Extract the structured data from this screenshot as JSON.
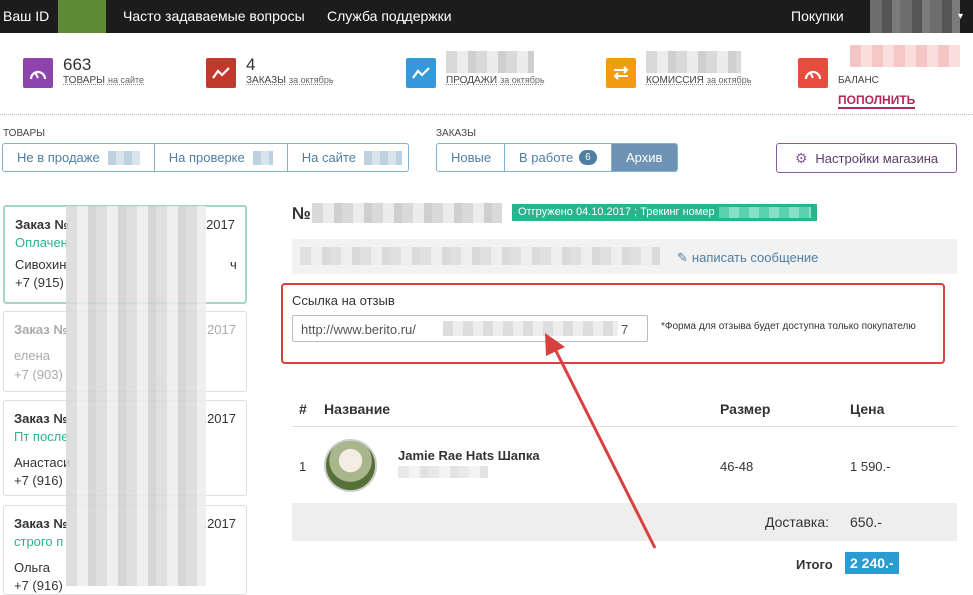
{
  "topbar": {
    "brand": "Ваш ID",
    "faq": "Часто задаваемые вопросы",
    "support": "Служба поддержки",
    "purchases": "Покупки",
    "dropdown": "▾"
  },
  "stats": {
    "products": {
      "value": "663",
      "label": "ТОВАРЫ",
      "sub": "на сайте",
      "color": "#8e44ad"
    },
    "orders": {
      "value": "4",
      "label": "ЗАКАЗЫ",
      "sub": "за октябрь",
      "color": "#c0392b"
    },
    "sales": {
      "label": "ПРОДАЖИ",
      "sub": "за октябрь",
      "color": "#3498db"
    },
    "commission": {
      "label": "КОМИССИЯ",
      "sub": "за октябрь",
      "color": "#f39c12"
    },
    "balance": {
      "label": "БАЛАНС",
      "topup": "ПОПОЛНИТЬ",
      "color": "#e74c3c"
    }
  },
  "goods_section": {
    "title": "ТОВАРЫ",
    "tabs": [
      "Не в продаже",
      "На проверке",
      "На сайте"
    ]
  },
  "orders_section": {
    "title": "ЗАКАЗЫ",
    "tabs": [
      "Новые",
      "В работе",
      "Архив"
    ],
    "in_work_count": "6"
  },
  "settings_label": "Настройки магазина",
  "order_cards": [
    {
      "title": "Заказ №",
      "date": ".2017",
      "status": "Оплачен",
      "name": "Сивохин",
      "name_end": "ч",
      "phone": "+7 (915)",
      "status_color": "#2bb38e"
    },
    {
      "title": "Заказ №",
      "date": ".2017",
      "status": "",
      "name": "елена",
      "name_end": "",
      "phone": "+7 (903)",
      "status_color": "#2bb38e"
    },
    {
      "title": "Заказ №",
      "date": ".2017",
      "status": "Пт после",
      "name": "Анастаси",
      "name_end": "",
      "phone": "+7 (916)",
      "status_color": "#2bb38e"
    },
    {
      "title": "Заказ №",
      "date": ".2017",
      "status": "строго п",
      "name": "Ольга",
      "name_end": "",
      "phone": "+7 (916)",
      "status_color": "#2bb38e"
    }
  ],
  "detail": {
    "order_prefix": "№",
    "shipped": "Отгружено 04.10.2017 ; Трекинг номер",
    "write_message": "написать сообщение",
    "review_label": "Ссылка на отзыв",
    "review_url": "http://www.berito.ru/",
    "review_url_end": "7",
    "review_note": "*Форма для отзыва будет доступна только покупателю"
  },
  "table": {
    "headers": {
      "no": "#",
      "name": "Название",
      "size": "Размер",
      "price": "Цена"
    },
    "rows": [
      {
        "no": "1",
        "name": "Jamie Rae Hats Шапка",
        "size": "46-48",
        "price": "1 590.-"
      }
    ],
    "delivery_label": "Доставка:",
    "delivery_value": "650.-",
    "total_label": "Итого",
    "total_value": "2 240.-"
  }
}
